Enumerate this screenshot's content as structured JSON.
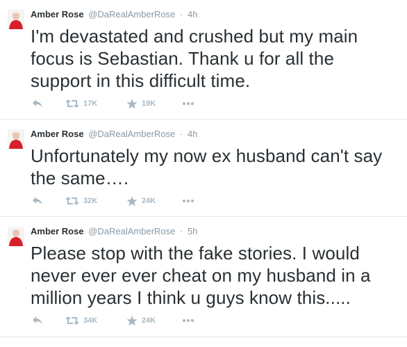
{
  "tweets": [
    {
      "name": "Amber Rose",
      "handle": "@DaRealAmberRose",
      "separator": "·",
      "time": "4h",
      "text": "I'm devastated and crushed but my main focus is Sebastian. Thank u for all the support in this difficult time.",
      "retweets": "17K",
      "favorites": "19K"
    },
    {
      "name": "Amber Rose",
      "handle": "@DaRealAmberRose",
      "separator": "·",
      "time": "4h",
      "text": "Unfortunately my now ex husband can't say the same….",
      "retweets": "32K",
      "favorites": "24K"
    },
    {
      "name": "Amber Rose",
      "handle": "@DaRealAmberRose",
      "separator": "·",
      "time": "5h",
      "text": "Please stop with the fake stories. I would never ever ever cheat on my husband in a million years I think u guys know this.....",
      "retweets": "34K",
      "favorites": "24K"
    }
  ],
  "icons": {
    "reply": "reply-icon",
    "retweet": "retweet-icon",
    "favorite": "star-icon",
    "more": "more-dots-icon"
  },
  "colors": {
    "text": "#292f33",
    "muted": "#8899a6",
    "action": "#aab8c2",
    "divider": "#e1e8ed"
  }
}
